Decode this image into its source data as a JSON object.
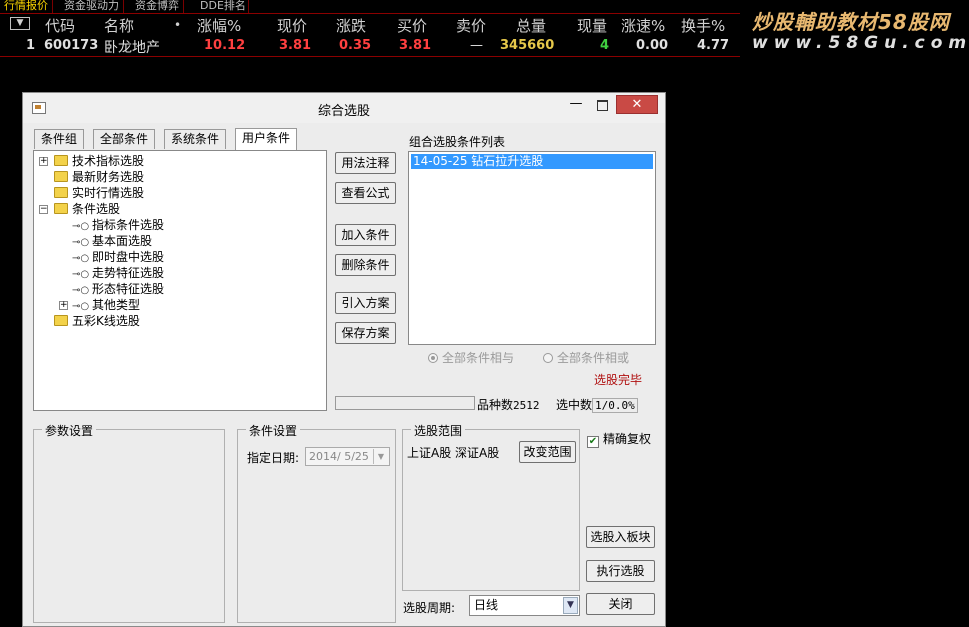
{
  "top_tabs": [
    "行情报价",
    "资金驱动力",
    "资金博弈",
    "DDE排名"
  ],
  "table": {
    "dropdown_glyph": "▼",
    "headers": [
      "代码",
      "名称",
      "•",
      "涨幅%",
      "现价",
      "涨跌",
      "买价",
      "卖价",
      "总量",
      "现量",
      "涨速%",
      "换手%"
    ],
    "row": {
      "index": "1",
      "code": "600173",
      "name": "卧龙地产",
      "change_pct": "10.12",
      "price": "3.81",
      "change": "0.35",
      "bid": "3.81",
      "ask": "—",
      "volume": "345660",
      "last_vol": "4",
      "speed": "0.00",
      "turnover": "4.77"
    },
    "colors": {
      "up": "#ff4040",
      "volume": "#e6c84a",
      "last_vol": "#40d040",
      "neutral": "#e0e0e0"
    }
  },
  "watermark": {
    "line1": "炒股輔助教材58股网",
    "line2": "www.58Gu.com"
  },
  "dialog": {
    "title": "综合选股",
    "tabs": [
      "条件组",
      "全部条件",
      "系统条件",
      "用户条件"
    ],
    "tree": [
      "技术指标选股",
      "最新财务选股",
      "实时行情选股",
      "条件选股",
      "指标条件选股",
      "基本面选股",
      "即时盘中选股",
      "走势特征选股",
      "形态特征选股",
      "其他类型",
      "五彩K线选股"
    ],
    "buttons": {
      "usage": "用法注释",
      "view_formula": "查看公式",
      "add_condition": "加入条件",
      "delete_condition": "删除条件",
      "import_plan": "引入方案",
      "save_plan": "保存方案",
      "change_range": "改变范围",
      "to_block": "选股入板块",
      "execute": "执行选股",
      "close": "关闭"
    },
    "condition_list": {
      "label": "组合选股条件列表",
      "items": [
        "14-05-25 钻石拉升选股"
      ]
    },
    "logic": {
      "and_label": "全部条件相与",
      "or_label": "全部条件相或"
    },
    "status": "选股完毕",
    "stats": {
      "count_label": "品种数",
      "count_value": "2512",
      "selected_label": "选中数",
      "selected_value": "1/0.0%"
    },
    "params": {
      "label": "参数设置"
    },
    "condition_settings": {
      "label": "条件设置",
      "date_label": "指定日期:",
      "date_value": "2014/ 5/25"
    },
    "range": {
      "label": "选股范围",
      "value": "上证A股 深证A股"
    },
    "precise_restore": "精确复权",
    "period": {
      "label": "选股周期:",
      "value": "日线"
    }
  }
}
